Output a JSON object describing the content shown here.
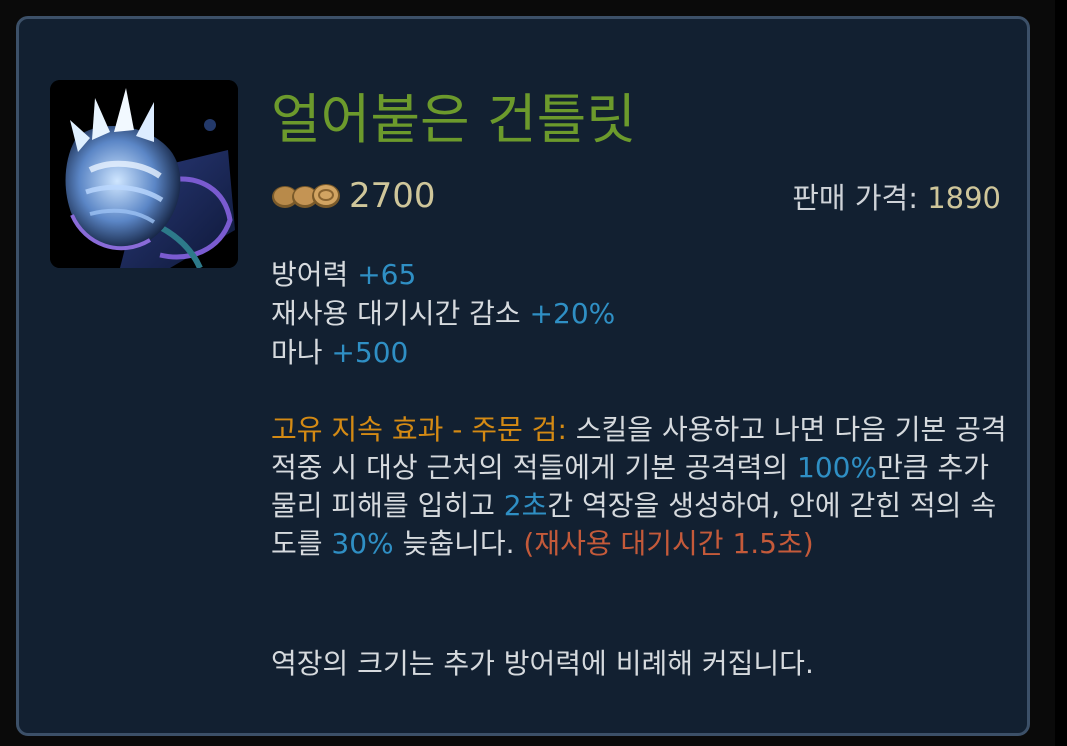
{
  "item": {
    "name": "얼어붙은 건틀릿",
    "icon": "frozen-gauntlet-icon",
    "price": "2700",
    "sell_label": "판매 가격: ",
    "sell_value": "1890"
  },
  "stats": [
    {
      "label": "방어력 ",
      "value": "+65"
    },
    {
      "label": "재사용 대기시간 감소 ",
      "value": "+20%"
    },
    {
      "label": "마나 ",
      "value": "+500"
    }
  ],
  "passive": {
    "title": "고유 지속 효과 - 주문 검:",
    "t1": " 스킬을 사용하고 나면 다음 기본 공격 적중 시 대상 근처의 적들에게 기본 공격력의 ",
    "v1": "100%",
    "t2": "만큼 추가 물리 피해를 입히고 ",
    "v2": "2초",
    "t3": "간 역장을 생성하여, 안에 갇힌 적의 속도를 ",
    "v3": "30%",
    "t4": " 늦춥니다. ",
    "cooldown": "(재사용 대기시간 1.5초)"
  },
  "note": "역장의 크기는 추가 방어력에 비례해 커집니다.",
  "colors": {
    "name": "#6c9a2c",
    "gold": "#cfc69a",
    "stat_value": "#2f8fc4",
    "passive_title": "#d48a14",
    "cooldown": "#c45a3a",
    "background": "#122031",
    "border": "#3c5068"
  }
}
